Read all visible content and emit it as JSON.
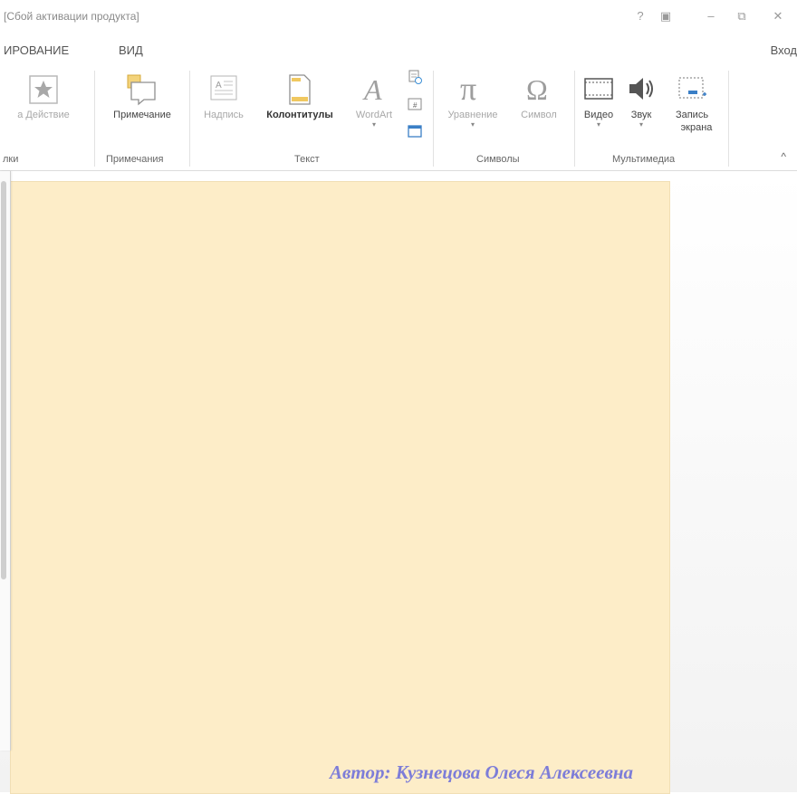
{
  "window": {
    "title": "[Сбой активации продукта]",
    "controls": {
      "help": "?",
      "ribbon_options": "▣",
      "minimize": "–",
      "restore": "⧉",
      "close": "✕"
    }
  },
  "tabs": {
    "items": [
      {
        "label": "ИРОВАНИЕ"
      },
      {
        "label": "ВИД"
      }
    ],
    "signin": "Вход"
  },
  "ribbon": {
    "groups": {
      "links": {
        "label": "лки",
        "buttons": {
          "partial": "а",
          "action": "Действие"
        }
      },
      "comments": {
        "label": "Примечания",
        "buttons": {
          "comment": "Примечание"
        }
      },
      "text": {
        "label": "Текст",
        "buttons": {
          "textbox": "Надпись",
          "header_footer": "Колонтитулы",
          "wordart": "WordArt"
        }
      },
      "symbols": {
        "label": "Символы",
        "buttons": {
          "equation": "Уравнение",
          "symbol": "Символ"
        }
      },
      "media": {
        "label": "Мультимедиа",
        "buttons": {
          "video": "Видео",
          "audio": "Звук",
          "screen_recording_1": "Запись",
          "screen_recording_2": "экрана"
        }
      }
    },
    "collapse": "^"
  },
  "slide": {
    "author": "Автор: Кузнецова Олеся Алексеевна",
    "background_color": "#fdedc8",
    "author_color": "#7d7dd8"
  },
  "icons": {
    "action": "star-icon",
    "comment": "comment-icon",
    "textbox": "textbox-icon",
    "header_footer": "header-footer-icon",
    "wordart": "wordart-icon",
    "equation": "pi-icon",
    "symbol": "omega-icon",
    "video": "video-icon",
    "audio": "speaker-icon",
    "screen_recording": "screen-recording-icon"
  }
}
